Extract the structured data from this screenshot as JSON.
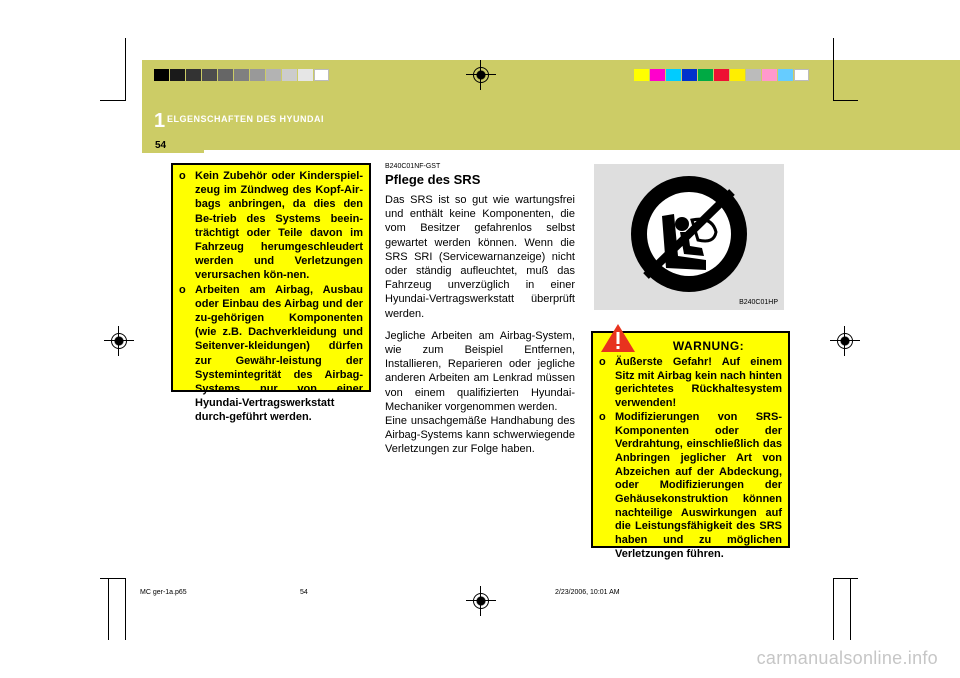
{
  "header": {
    "chapter_number": "1",
    "chapter_title": "ELGENSCHAFTEN DES HYUNDAI",
    "page_number": "54",
    "band_color": "#cccc66"
  },
  "color_bars": {
    "gray": [
      "#000000",
      "#1a1a1a",
      "#333333",
      "#4d4d4d",
      "#666666",
      "#808080",
      "#999999",
      "#b3b3b3",
      "#cccccc",
      "#e6e6e6",
      "#ffffff"
    ],
    "color": [
      "#ffff00",
      "#ff00cc",
      "#00ccff",
      "#0033cc",
      "#00aa44",
      "#ee1133",
      "#ffee00",
      "#bbbbbb",
      "#ff99cc",
      "#66ccff",
      "#ffffff"
    ]
  },
  "left_notice": {
    "items": [
      "Kein Zubehör oder Kinderspiel-zeug im Zündweg des Kopf-Air-bags anbringen, da dies den Be-trieb des Systems beein-trächtigt oder Teile davon im Fahrzeug herumgeschleudert werden und Verletzungen verursachen kön-nen.",
      "Arbeiten am Airbag, Ausbau oder Einbau des Airbag und der zu-gehörigen Komponenten (wie z.B. Dachverkleidung und Seitenver-kleidungen) dürfen zur Gewähr-leistung der Systemintegrität des Airbag-Systems nur von einer Hyundai-Vertragswerkstatt durch-geführt werden."
    ]
  },
  "section": {
    "code": "B240C01NF-GST",
    "title": "Pflege des SRS",
    "paragraph1": "Das SRS ist so gut wie wartungsfrei und enthält keine Komponenten, die vom Besitzer gefahrenlos selbst gewartet werden können. Wenn die SRS SRI (Servicewarnanzeige) nicht oder ständig aufleuchtet, muß das Fahrzeug unverzüglich in einer Hyundai-Vertragswerkstatt überprüft werden.",
    "paragraph2": "Jegliche Arbeiten am Airbag-System, wie zum Beispiel Entfernen, Installieren, Reparieren oder jegliche anderen Arbeiten am Lenkrad müssen von einem qualifizierten Hyundai-Mechaniker vorgenommen werden.",
    "paragraph3": "Eine unsachgemäße Handhabung des Airbag-Systems kann schwerwiegende Verletzungen zur Folge haben."
  },
  "figure": {
    "icon_text": "AIRBAG",
    "code": "B240C01HP"
  },
  "warning": {
    "heading": "WARNUNG:",
    "items": [
      "Äußerste Gefahr! Auf einem Sitz mit Airbag kein nach hinten gerichtetes Rückhaltesystem verwenden!",
      "Modifizierungen von SRS-Komponenten oder der Verdrahtung, einschließlich das Anbringen jeglicher Art von Abzeichen auf der Abdeckung, oder Modifizierungen der Gehäusekonstruktion können nachteilige Auswirkungen auf die Leistungsfähigkeit des SRS haben und zu möglichen Verletzungen führen."
    ]
  },
  "footer": {
    "file": "MC ger-1a.p65",
    "page": "54",
    "date": "2/23/2006, 10:01 AM"
  },
  "watermark": "carmanualsonline.info"
}
